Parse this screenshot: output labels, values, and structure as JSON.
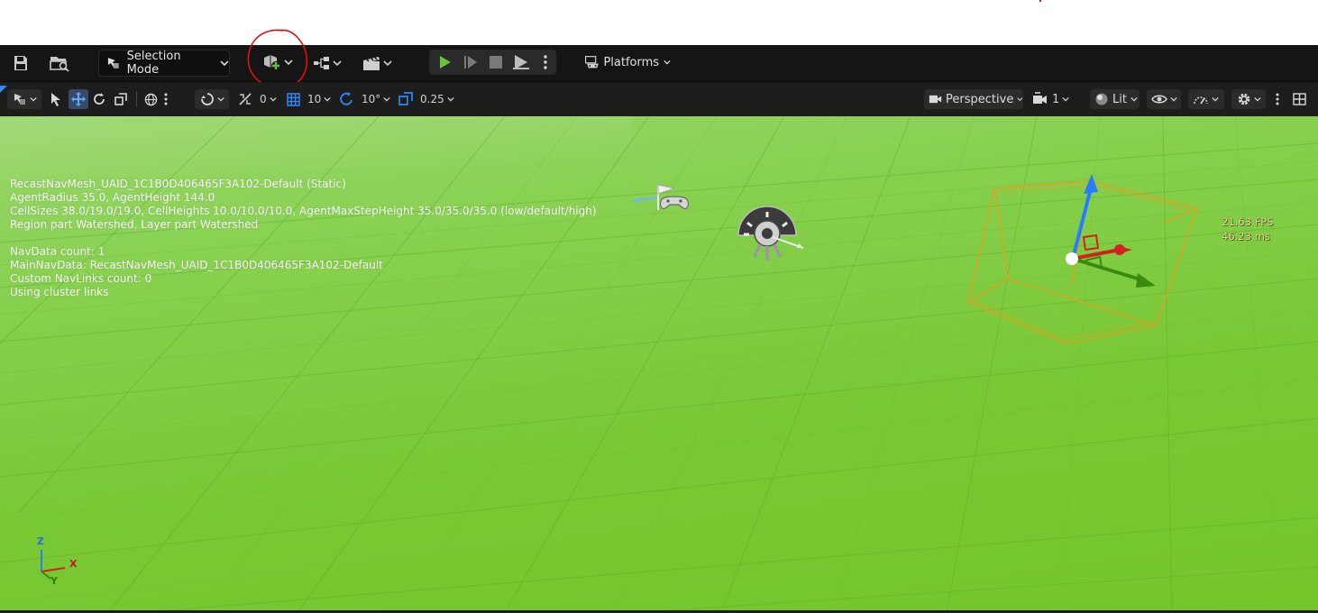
{
  "toolbar": {
    "selection_mode_label": "Selection Mode",
    "platforms_label": "Platforms",
    "icons": [
      "save-icon",
      "content-browser-icon",
      "add-actor-icon",
      "blueprint-icon",
      "cinematics-icon",
      "play-icon",
      "advance-frame-icon",
      "stop-icon",
      "eject-icon",
      "more-options-icon",
      "platforms-icon"
    ]
  },
  "viewport_toolbar": {
    "rotation_snap_value": "0",
    "grid_snap_value": "10",
    "angle_snap_value": "10°",
    "scale_snap_value": "0.25",
    "view_mode_label": "Perspective",
    "camera_speed_value": "1",
    "lighting_mode_label": "Lit"
  },
  "navmesh_debug": {
    "lines": [
      "RecastNavMesh_UAID_1C1B0D406465F3A102-Default (Static)",
      "AgentRadius 35.0, AgentHeight 144.0",
      "CellSizes 38.0/19.0/19.0, CellHeights 10.0/10.0/10.0, AgentMaxStepHeight 35.0/35.0/35.0 (low/default/high)",
      "Region part Watershed, Layer part Watershed",
      "",
      "NavData count: 1",
      "MainNavData: RecastNavMesh_UAID_1C1B0D406465F3A102-Default",
      "Custom NavLinks count: 0",
      "Using cluster links"
    ]
  },
  "stats": {
    "fps": "21.63 FPS",
    "ms": "46.23 ms"
  },
  "axis": {
    "z": "Z",
    "x": "X",
    "y": "Y"
  },
  "colors": {
    "accent_blue": "#2a8cff",
    "play_green": "#6bbf3a",
    "annotation_red": "#e01010",
    "selection_orange": "#e0a020"
  }
}
